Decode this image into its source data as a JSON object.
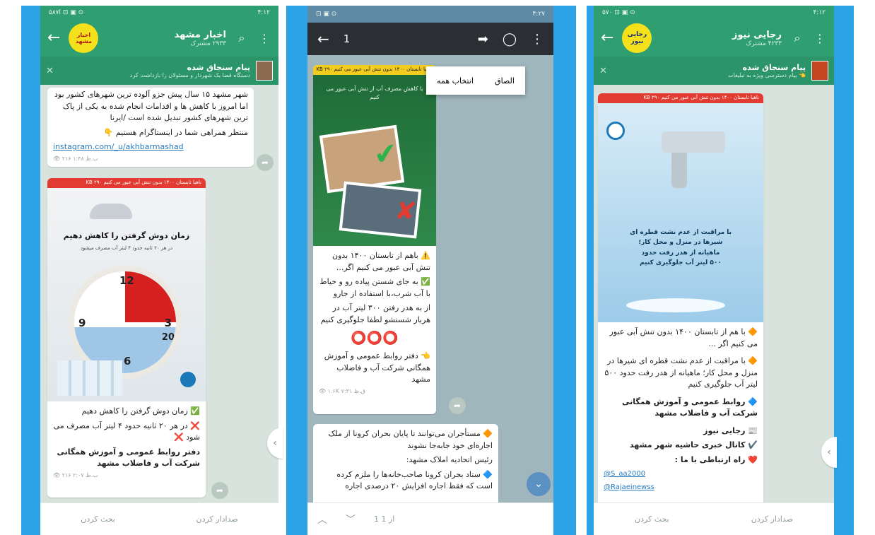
{
  "colors": {
    "frame": "#2ba3e6",
    "tg_header": "#2f9e70",
    "accent_red": "#e23b32",
    "action_bar": "#2b2f33"
  },
  "left": {
    "status": {
      "left": "ا۵۸۷ ⊡ ▣ ⊙",
      "right": "۴:۱۲"
    },
    "title": "اخبار مشهد",
    "avatar_text": "اخبار مشهد",
    "subtitle": "۲۹۳۳ مشترک",
    "pinned": {
      "title": "پیام سنجاق شده",
      "preview": "دستگاه قضا یک شهردار و مسئولان را بازداشت کرد"
    },
    "msg1": {
      "text": "شهر مشهد ۱۵ سال پیش جزو آلوده ترین شهرهای کشور بود اما امروز با کاهش ها و اقدامات انجام شده به یکی از پاک ترین شهرهای کشور تبدیل شده است /ایرنا",
      "cta": "منتظر همراهی شما در اینستاگرام هستیم 👇",
      "link": "instagram.com/_u/akhbarmashad",
      "meta": "👁 ۲۱۶ ۱:۴۸ ب.ظ"
    },
    "msg2": {
      "bar": "ناهیا تابستان ۱۴۰۰ بدون تنش آبی عبور می کنیم KB ۲۹۰",
      "poster_title": "زمان دوش گرفتن را کاهش دهیم",
      "poster_sub": "در هر ۲۰ ثانیه حدود ۴ لیتر آب مصرف میشود",
      "clock": [
        "12",
        "3",
        "6",
        "9",
        "20"
      ],
      "line1": "✅ زمان دوش گرفتن را کاهش دهیم",
      "line2": "❌ در هر ۲۰ ثانیه حدود ۴ لیتر آب مصرف می شود ❌",
      "line3": "دفتر روابط عمومی و آموزش همگانی شرکت آب و فاضلاب مشهد",
      "meta": "👁 ۲۱۶ ۲:۰۷ ب.ظ"
    },
    "bottom": {
      "mute": "صدادار کردن",
      "discuss": "بحث کردن"
    }
  },
  "middle": {
    "status": {
      "left": "⊡ ▣ ⊙",
      "right": "۴:۲۷"
    },
    "count": "1",
    "context": {
      "select_all": "انتخاب همه",
      "paste": "الصاق"
    },
    "fwd_bar": "ناهیا تابستان ۱۴۰۰ بدون تنش آبی عبور می کنیم KB ۲۹۰",
    "poster_text": "با کاهش مصرف آب از تنش آبی عبور می کنیم",
    "msg1": {
      "lines": [
        "⚠️ باهم از تابستان ۱۴۰۰ بدون تنش آبی عبور می کنیم اگر...",
        "✅ به جای شستن پیاده رو و حیاط با آب شرب،با استفاده از جارو",
        "از به هدر رفتن ۳۰۰ لیتر آب در هربار شستشو لطفا جلوگیری کنیم"
      ],
      "circles": "⭕⭕⭕",
      "footer": "👈 دفتر روابط عمومی و آموزش همگانی شرکت آب و فاضلاب مشهد",
      "meta": "👁 ۱.۶K ۷:۳۱ ق.ظ"
    },
    "msg2": {
      "line1": "🔶 مستأجران می‌توانند تا پایان بحران کرونا از ملک اجاره‌ای خود جابه‌جا نشوند",
      "line2": "رئیس اتحادیه املاک مشهد:",
      "line3": "🔷 ستاد بحران کرونا صاحب‌خانه‌ها را ملزم کرده است که فقط اجاره افزایش ۲۰ درصدی اجاره"
    },
    "bottom": {
      "counter": "1 از 1"
    }
  },
  "right": {
    "status": {
      "left": "۵۷۰ ⊡ ▣ ⊙",
      "right": "۴:۱۲"
    },
    "title": "رجایی نیوز",
    "avatar_text": "رجایی نیوز",
    "subtitle": "۴۲۳۳ مشترک",
    "pinned": {
      "title": "پیام سنجاق شده",
      "preview": "👈 پیام دسترسی ویژه به تبلیغات"
    },
    "bar": "ناهیا تابستان ۱۴۰۰ بدون تنش آبی عبور می کنیم KB ۲۹۰",
    "poster_text": [
      "با مراقبت از عدم نشت قطره ای",
      "شیرها در منزل و محل کار؛",
      "ماهیانه از هدر رفت حدود",
      "۵۰۰ لیتر آب جلوگیری کنیم"
    ],
    "lines": [
      "🔶 با هم از تابستان ۱۴۰۰ بدون تنش آبی عبور می کنیم اگر ...",
      "🔶 با مراقبت از عدم نشت قطره ای شیرها در منزل و محل کار؛ ماهیانه از هدر رفت حدود ۵۰۰ لیتر آب جلوگیری کنیم",
      "🔷 روابط عمومی و آموزش همگانی شرکت آب و فاضلاب مشهد",
      "📰 رجایی نیوز",
      "✔️ کانال خبری حاشیه شهر مشهد",
      "❤️ راه ارتباطی با ما :"
    ],
    "contact1": "@S_aa2000",
    "contact2": "@Rajaeinewss",
    "bottom": {
      "mute": "صدادار کردن",
      "discuss": "بحث کردن"
    }
  }
}
